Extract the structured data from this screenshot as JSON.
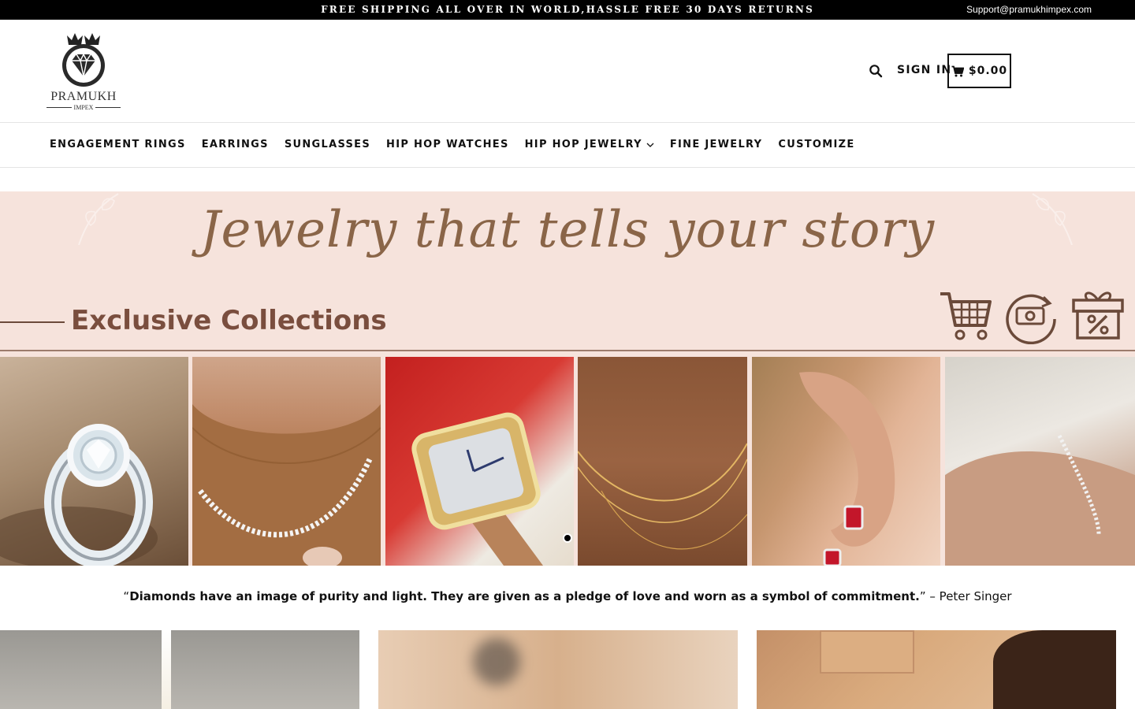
{
  "announcement": {
    "text": "FREE SHIPPING ALL OVER IN WORLD,HASSLE FREE 30 DAYS RETURNS",
    "email": "Support@pramukhimpex.com"
  },
  "logo": {
    "name": "PRAMUKH",
    "sub": "IMPEX"
  },
  "header": {
    "signin_label": "SIGN IN",
    "cart_total": "$0.00"
  },
  "nav": {
    "items": [
      {
        "label": "ENGAGEMENT RINGS"
      },
      {
        "label": "EARRINGS"
      },
      {
        "label": "SUNGLASSES"
      },
      {
        "label": "HIP HOP WATCHES"
      },
      {
        "label": "HIP HOP JEWELRY"
      },
      {
        "label": "FINE JEWELRY"
      },
      {
        "label": "CUSTOMIZE"
      }
    ]
  },
  "hero": {
    "title": "Jewelry that tells your story",
    "subtitle": "Exclusive Collections",
    "icons": [
      "cart-icon",
      "money-refresh-icon",
      "gift-discount-icon"
    ],
    "tiles": [
      "ring",
      "necklace",
      "watch",
      "chain",
      "earring",
      "bracelet"
    ]
  },
  "quote": {
    "open": "“",
    "text": "Diamonds have an image of purity and light. They are given as a pledge of love and worn as a symbol of commitment.",
    "close": "”",
    "author": " – Peter Singer"
  },
  "colors": {
    "hero_bg": "#f6e3dc",
    "hero_title": "#8a6548",
    "hero_subtitle": "#7a4e3e",
    "announcement_bg": "#000000"
  }
}
